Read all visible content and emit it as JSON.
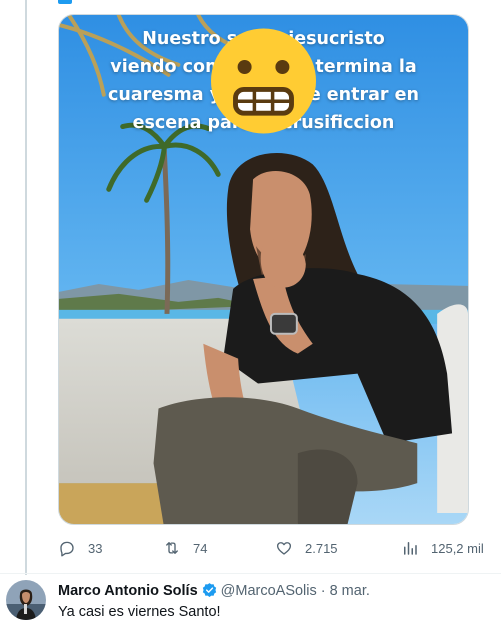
{
  "post": {
    "image_caption": [
      "Nuestro señor jesucristo",
      "viendo como ya casi termina la",
      "cuaresma y tiene que entrar en",
      "escena para la crusificcion"
    ],
    "caption_emoji": "grimacing-face"
  },
  "actions": {
    "replies": "33",
    "reposts": "74",
    "likes": "2.715",
    "views": "125,2 mil"
  },
  "reply": {
    "name": "Marco Antonio Solís",
    "handle": "@MarcoASolis",
    "separator": "·",
    "date": "8 mar.",
    "text": "Ya casi es viernes Santo!",
    "verified": true
  },
  "colors": {
    "accent": "#1d9bf0",
    "muted_text": "#536471",
    "thread_line": "#cfd9de"
  }
}
